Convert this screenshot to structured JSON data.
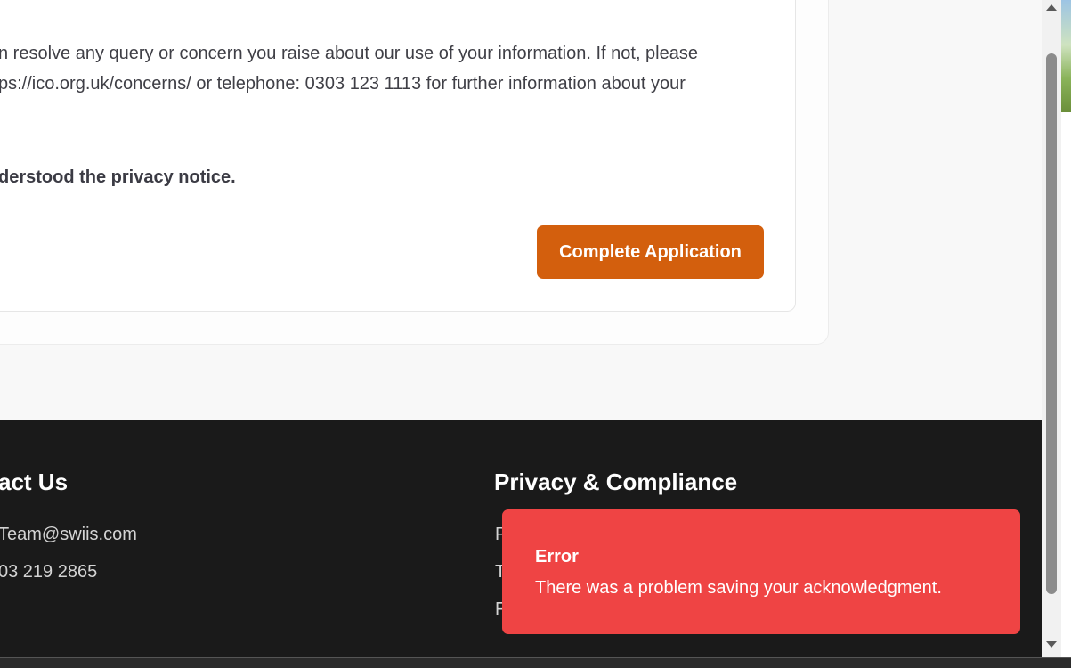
{
  "content": {
    "paragraph_line_1": "n resolve any query or concern you raise about our use of your information. If not, please",
    "paragraph_line_2": "ps://ico.org.uk/concerns/ or telephone: 0303 123 1113 for further information about your",
    "acknowledgment": "derstood the privacy notice.",
    "complete_button_label": "Complete Application"
  },
  "footer": {
    "contact_heading": "act Us",
    "contact_email": "Team@swiis.com",
    "contact_phone": "03 219 2865",
    "privacy_heading": "Privacy & Compliance",
    "privacy_links": [
      "P",
      "T",
      "F"
    ]
  },
  "toast": {
    "title": "Error",
    "message": "There was a problem saving your acknowledgment."
  },
  "colors": {
    "button": "#d35f0d",
    "toast": "#ef4444",
    "footer": "#1a1a1a"
  },
  "icons": {
    "scroll_up": "triangle-up",
    "scroll_down": "triangle-down"
  }
}
